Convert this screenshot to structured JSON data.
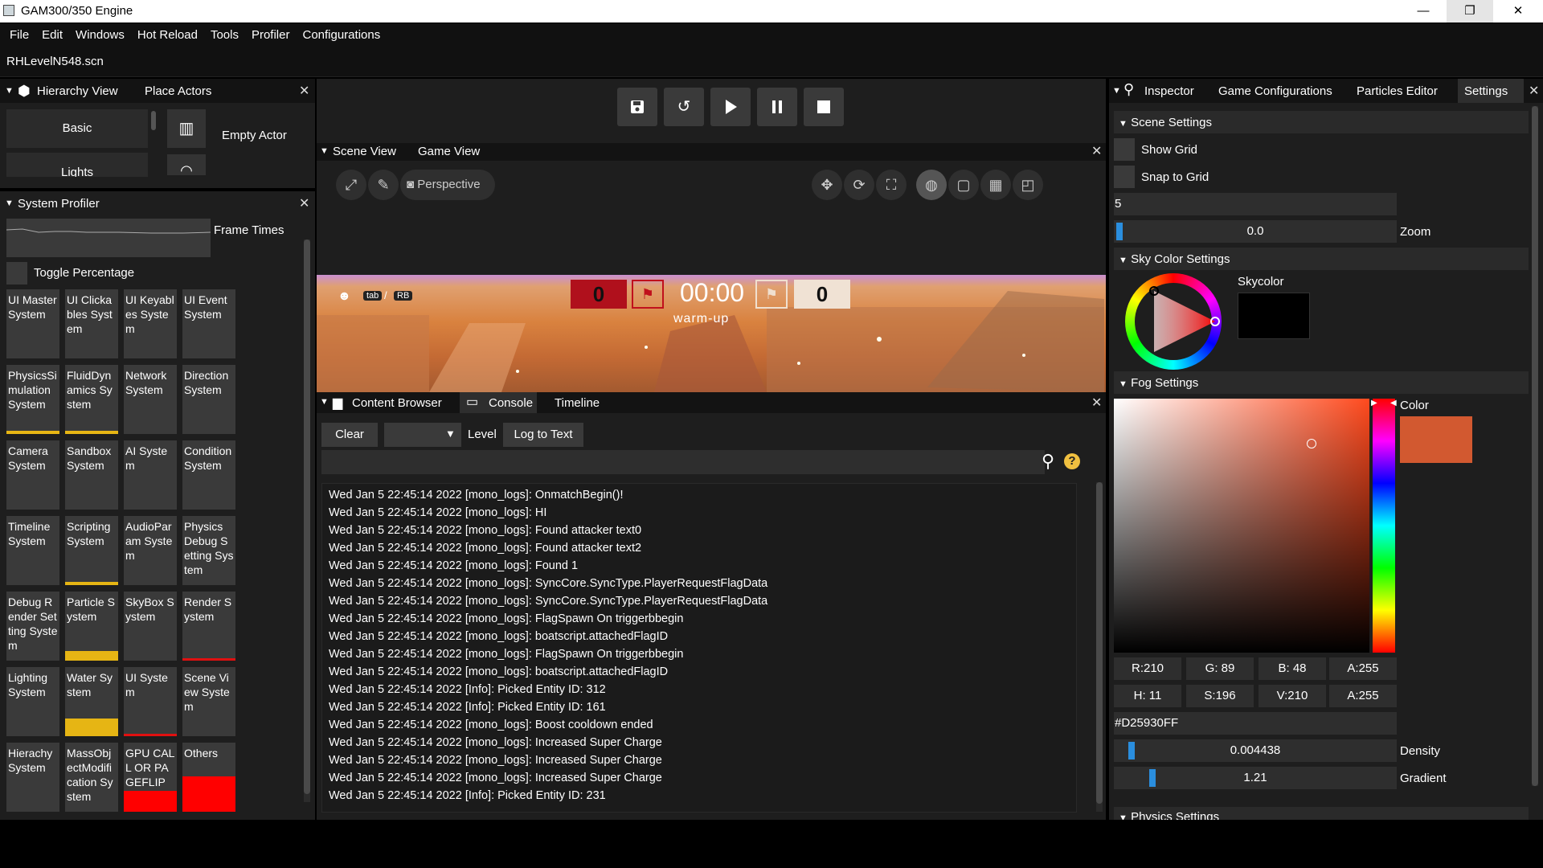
{
  "window": {
    "title": "GAM300/350 Engine",
    "min": "—",
    "restore": "❐",
    "close": "✕"
  },
  "menu": [
    "File",
    "Edit",
    "Windows",
    "Hot Reload",
    "Tools",
    "Profiler",
    "Configurations"
  ],
  "scene_file": "RHLevelN548.scn",
  "hierarchy": {
    "tabs": [
      "Hierarchy View",
      "Place Actors"
    ],
    "categories": [
      "Basic",
      "Lights"
    ],
    "actor_label": "Empty Actor"
  },
  "profiler": {
    "title": "System Profiler",
    "frame_times_label": "Frame Times",
    "toggle_label": "Toggle Percentage",
    "systems": [
      {
        "label": "UI Master System",
        "bar": "none"
      },
      {
        "label": "UI Clickables System",
        "bar": "none"
      },
      {
        "label": "UI Keyables System",
        "bar": "none"
      },
      {
        "label": "UI Event System",
        "bar": "none"
      },
      {
        "label": "PhysicsSimulation System",
        "bar": "thin-yellow"
      },
      {
        "label": "FluidDynamics System",
        "bar": "thin-yellow"
      },
      {
        "label": "Network System",
        "bar": "none"
      },
      {
        "label": "Direction System",
        "bar": "none"
      },
      {
        "label": "Camera System",
        "bar": "none"
      },
      {
        "label": "Sandbox System",
        "bar": "none"
      },
      {
        "label": "AI System",
        "bar": "none"
      },
      {
        "label": "Condition System",
        "bar": "none"
      },
      {
        "label": "Timeline System",
        "bar": "none"
      },
      {
        "label": "Scripting System",
        "bar": "thin-yellow"
      },
      {
        "label": "AudioParam System",
        "bar": "none"
      },
      {
        "label": "Physics Debug Setting System",
        "bar": "none"
      },
      {
        "label": "Debug Render Setting System",
        "bar": "none"
      },
      {
        "label": "Particle System",
        "bar": "mid-yellow"
      },
      {
        "label": "SkyBox System",
        "bar": "none"
      },
      {
        "label": "Render System",
        "bar": "thin-red"
      },
      {
        "label": "Lighting System",
        "bar": "none"
      },
      {
        "label": "Water System",
        "bar": "big-yellow"
      },
      {
        "label": "UI System",
        "bar": "thin-red"
      },
      {
        "label": "Scene View System",
        "bar": "none"
      },
      {
        "label": "Hierachy System",
        "bar": "none"
      },
      {
        "label": "MassObjectModification System",
        "bar": "none"
      },
      {
        "label": "GPU CALL OR PAGEFLIP",
        "bar": "big-red"
      },
      {
        "label": "Others",
        "bar": "full-red"
      }
    ]
  },
  "toolbar": {
    "icons": [
      "save-icon",
      "undo-icon",
      "play-icon",
      "pause-icon",
      "stop-icon"
    ]
  },
  "scene": {
    "tabs": [
      "Scene View",
      "Game View"
    ],
    "perspective_label": "Perspective",
    "hud": {
      "score_left": "0",
      "timer": "00:00",
      "score_right": "0",
      "phase": "warm-up",
      "tab_key": "tab",
      "rb_key": "RB"
    }
  },
  "console": {
    "tabs": [
      "Content Browser",
      "Console",
      "Timeline"
    ],
    "clear_label": "Clear",
    "level_label": "Level",
    "log_to_text_label": "Log to Text",
    "search_value": "",
    "logs": [
      "Wed Jan  5 22:45:14 2022 [mono_logs]: OnmatchBegin()!",
      "Wed Jan  5 22:45:14 2022 [mono_logs]: HI",
      "Wed Jan  5 22:45:14 2022 [mono_logs]: Found attacker text0",
      "Wed Jan  5 22:45:14 2022 [mono_logs]: Found attacker text2",
      "Wed Jan  5 22:45:14 2022 [mono_logs]: Found 1",
      "Wed Jan  5 22:45:14 2022 [mono_logs]: SyncCore.SyncType.PlayerRequestFlagData",
      "Wed Jan  5 22:45:14 2022 [mono_logs]: SyncCore.SyncType.PlayerRequestFlagData",
      "Wed Jan  5 22:45:14 2022 [mono_logs]: FlagSpawn On triggerbbegin",
      "Wed Jan  5 22:45:14 2022 [mono_logs]: boatscript.attachedFlagID",
      "Wed Jan  5 22:45:14 2022 [mono_logs]: FlagSpawn On triggerbbegin",
      "Wed Jan  5 22:45:14 2022 [mono_logs]: boatscript.attachedFlagID",
      "Wed Jan  5 22:45:14 2022 [Info]: Picked Entity ID:  312",
      "Wed Jan  5 22:45:14 2022 [Info]: Picked Entity ID:  161",
      "Wed Jan  5 22:45:14 2022 [mono_logs]: Boost cooldown ended",
      "Wed Jan  5 22:45:14 2022 [mono_logs]: Increased Super Charge",
      "Wed Jan  5 22:45:14 2022 [mono_logs]: Increased Super Charge",
      "Wed Jan  5 22:45:14 2022 [mono_logs]: Increased Super Charge",
      "Wed Jan  5 22:45:14 2022 [Info]: Picked Entity ID:  231"
    ]
  },
  "inspector": {
    "tabs": [
      "Inspector",
      "Game Configurations",
      "Particles Editor",
      "Settings"
    ],
    "scene_settings": {
      "title": "Scene Settings",
      "show_grid_label": "Show Grid",
      "snap_label": "Snap to Grid",
      "grid_value": "5",
      "zoom_value": "0.0",
      "zoom_label": "Zoom"
    },
    "sky": {
      "title": "Sky Color Settings",
      "label": "Skycolor",
      "color": "#000000"
    },
    "fog": {
      "title": "Fog Settings",
      "color_label": "Color",
      "color": "#D25930",
      "rgba": [
        "R:210",
        "G: 89",
        "B: 48",
        "A:255"
      ],
      "hsva": [
        "H: 11",
        "S:196",
        "V:210",
        "A:255"
      ],
      "hex": "#D25930FF",
      "density_value": "0.004438",
      "density_label": "Density",
      "gradient_value": "1.21",
      "gradient_label": "Gradient"
    },
    "physics_title": "Physics Settings"
  }
}
